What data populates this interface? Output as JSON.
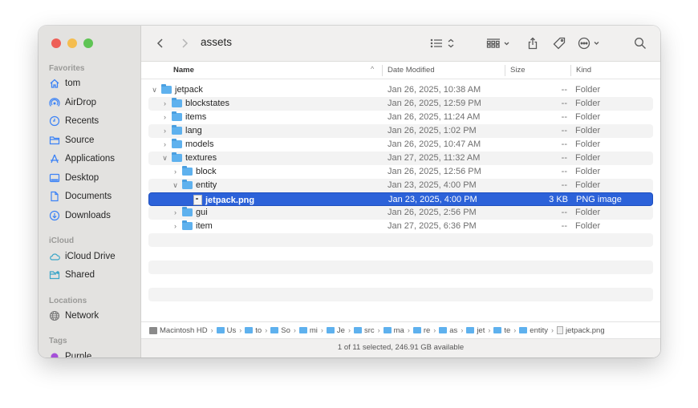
{
  "window": {
    "title": "assets",
    "traffic_lights": [
      "close",
      "minimize",
      "maximize"
    ]
  },
  "sidebar": {
    "sections": [
      {
        "label": "Favorites",
        "items": [
          {
            "label": "tom",
            "icon": "home-icon"
          },
          {
            "label": "AirDrop",
            "icon": "airdrop-icon"
          },
          {
            "label": "Recents",
            "icon": "clock-icon"
          },
          {
            "label": "Source",
            "icon": "folder-icon"
          },
          {
            "label": "Applications",
            "icon": "applications-icon"
          },
          {
            "label": "Desktop",
            "icon": "desktop-icon"
          },
          {
            "label": "Documents",
            "icon": "document-icon"
          },
          {
            "label": "Downloads",
            "icon": "download-icon"
          }
        ]
      },
      {
        "label": "iCloud",
        "items": [
          {
            "label": "iCloud Drive",
            "icon": "cloud-icon"
          },
          {
            "label": "Shared",
            "icon": "shared-folder-icon"
          }
        ]
      },
      {
        "label": "Locations",
        "items": [
          {
            "label": "Network",
            "icon": "globe-icon"
          }
        ]
      },
      {
        "label": "Tags",
        "items": [
          {
            "label": "Purple",
            "icon": "tag-dot-icon",
            "color": "#a550d8"
          }
        ]
      }
    ]
  },
  "toolbar": {
    "back": "back-icon",
    "forward": "forward-icon",
    "view_options": "list-view-icon",
    "group": "group-icon",
    "share": "share-icon",
    "tag": "tag-icon",
    "more": "more-icon",
    "search": "search-icon"
  },
  "columns": {
    "name": "Name",
    "date": "Date Modified",
    "size": "Size",
    "kind": "Kind"
  },
  "rows": [
    {
      "name": "jetpack",
      "level": 0,
      "expanded": true,
      "type": "folder",
      "date": "Jan 26, 2025, 10:38 AM",
      "size": "--",
      "kind": "Folder"
    },
    {
      "name": "blockstates",
      "level": 1,
      "expanded": false,
      "type": "folder",
      "date": "Jan 26, 2025, 12:59 PM",
      "size": "--",
      "kind": "Folder"
    },
    {
      "name": "items",
      "level": 1,
      "expanded": false,
      "type": "folder",
      "date": "Jan 26, 2025, 11:24 AM",
      "size": "--",
      "kind": "Folder"
    },
    {
      "name": "lang",
      "level": 1,
      "expanded": false,
      "type": "folder",
      "date": "Jan 26, 2025, 1:02 PM",
      "size": "--",
      "kind": "Folder"
    },
    {
      "name": "models",
      "level": 1,
      "expanded": false,
      "type": "folder",
      "date": "Jan 26, 2025, 10:47 AM",
      "size": "--",
      "kind": "Folder"
    },
    {
      "name": "textures",
      "level": 1,
      "expanded": true,
      "type": "folder",
      "date": "Jan 27, 2025, 11:32 AM",
      "size": "--",
      "kind": "Folder"
    },
    {
      "name": "block",
      "level": 2,
      "expanded": false,
      "type": "folder",
      "date": "Jan 26, 2025, 12:56 PM",
      "size": "--",
      "kind": "Folder"
    },
    {
      "name": "entity",
      "level": 2,
      "expanded": true,
      "type": "folder",
      "date": "Jan 23, 2025, 4:00 PM",
      "size": "--",
      "kind": "Folder"
    },
    {
      "name": "jetpack.png",
      "level": 3,
      "type": "file",
      "selected": true,
      "date": "Jan 23, 2025, 4:00 PM",
      "size": "3 KB",
      "kind": "PNG image"
    },
    {
      "name": "gui",
      "level": 2,
      "expanded": false,
      "type": "folder",
      "date": "Jan 26, 2025, 2:56 PM",
      "size": "--",
      "kind": "Folder"
    },
    {
      "name": "item",
      "level": 2,
      "expanded": false,
      "type": "folder",
      "date": "Jan 27, 2025, 6:36 PM",
      "size": "--",
      "kind": "Folder"
    }
  ],
  "pathbar": [
    {
      "label": "Macintosh HD",
      "icon": "disk-icon"
    },
    {
      "label": "Us",
      "icon": "folder-icon"
    },
    {
      "label": "to",
      "icon": "folder-icon"
    },
    {
      "label": "So",
      "icon": "folder-icon"
    },
    {
      "label": "mi",
      "icon": "folder-icon"
    },
    {
      "label": "Je",
      "icon": "folder-icon"
    },
    {
      "label": "src",
      "icon": "folder-icon"
    },
    {
      "label": "ma",
      "icon": "folder-icon"
    },
    {
      "label": "re",
      "icon": "folder-icon"
    },
    {
      "label": "as",
      "icon": "folder-icon"
    },
    {
      "label": "jet",
      "icon": "folder-icon"
    },
    {
      "label": "te",
      "icon": "folder-icon"
    },
    {
      "label": "entity",
      "icon": "folder-icon"
    },
    {
      "label": "jetpack.png",
      "icon": "file-icon"
    }
  ],
  "status": "1 of 11 selected, 246.91 GB available",
  "colors": {
    "selection": "#2c62d9",
    "folder": "#5eb1ee",
    "sidebar_icon": "#3b82f6"
  }
}
